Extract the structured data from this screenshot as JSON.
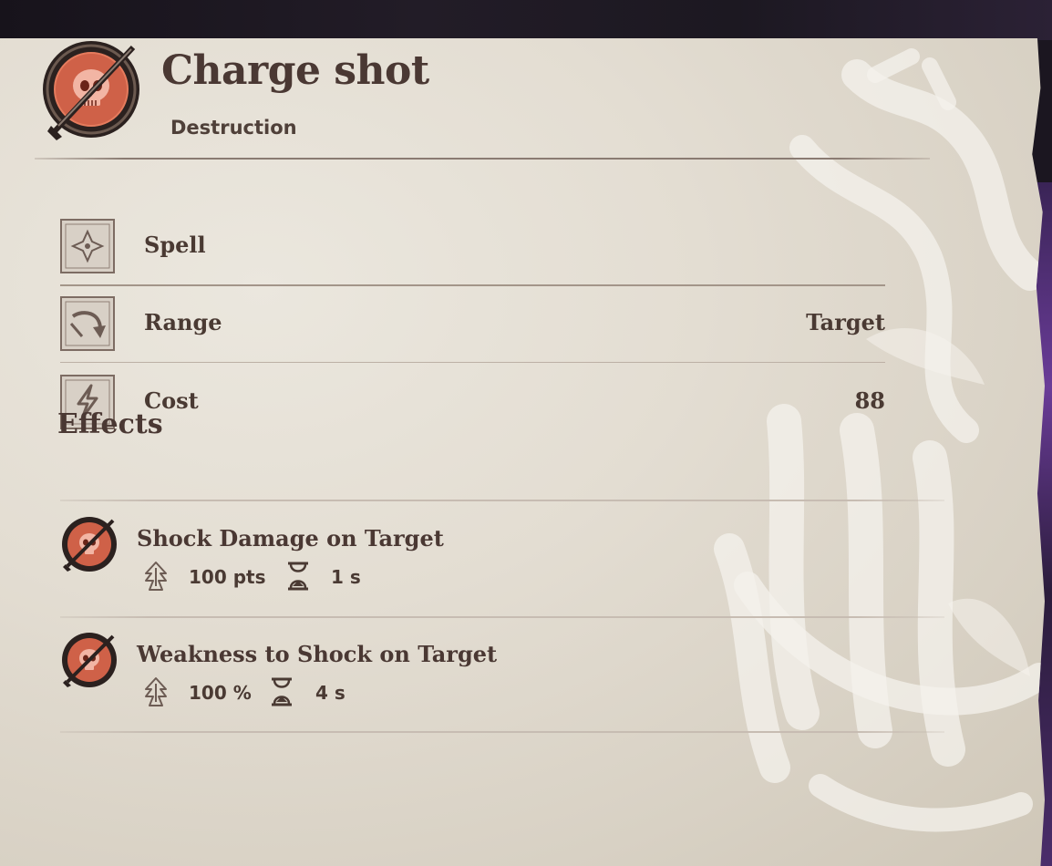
{
  "spell": {
    "title": "Charge shot",
    "school": "Destruction",
    "icon": "red-skull-icon"
  },
  "properties": [
    {
      "label": "Spell",
      "value": "",
      "icon": "spell-diamond-icon"
    },
    {
      "label": "Range",
      "value": "Target",
      "icon": "range-arrow-icon"
    },
    {
      "label": "Cost",
      "value": "88",
      "icon": "lightning-cost-icon"
    }
  ],
  "effects_heading": "Effects",
  "effects": [
    {
      "name": "Shock Damage on Target",
      "magnitude": "100 pts",
      "duration": "1 s",
      "icon": "red-skull-icon"
    },
    {
      "name": "Weakness to Shock on Target",
      "magnitude": "100 %",
      "duration": "4 s",
      "icon": "red-skull-icon"
    }
  ],
  "colors": {
    "parchment": "#e3ddd2",
    "text": "#4a3a33",
    "icon_red": "#d9694c",
    "icon_dark": "#2b211f"
  }
}
